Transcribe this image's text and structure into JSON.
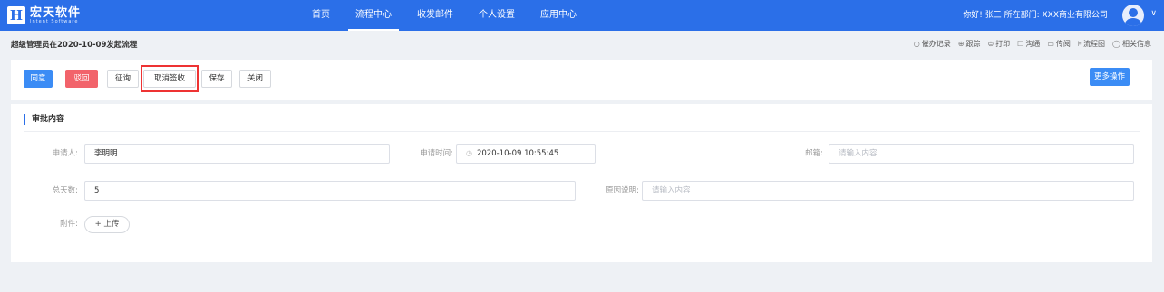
{
  "brand": {
    "logo_letter": "H",
    "name": "宏天软件",
    "sub": "Intent Software"
  },
  "nav": [
    {
      "label": "首页",
      "active": false
    },
    {
      "label": "流程中心",
      "active": true
    },
    {
      "label": "收发邮件",
      "active": false
    },
    {
      "label": "个人设置",
      "active": false
    },
    {
      "label": "应用中心",
      "active": false
    }
  ],
  "user": {
    "greeting": "你好! 张三 所在部门: XXX商业有限公司",
    "caret": "∨"
  },
  "crumb": "超级管理员在2020-10-09发起流程",
  "toolbar_links": [
    {
      "icon": "○",
      "label": "催办记录"
    },
    {
      "icon": "⊕",
      "label": "跟踪"
    },
    {
      "icon": "⊜",
      "label": "打印"
    },
    {
      "icon": "☐",
      "label": "沟通"
    },
    {
      "icon": "▭",
      "label": "传阅"
    },
    {
      "icon": "⊧",
      "label": "流程图"
    },
    {
      "icon": "◯",
      "label": "相关信息"
    }
  ],
  "actions": {
    "agree": "同意",
    "reject": "驳回",
    "consult": "征询",
    "cancel_sign": "取消签收",
    "save": "保存",
    "close": "关闭",
    "more": "更多操作"
  },
  "form": {
    "section_title": "审批内容",
    "applicant_label": "申请人:",
    "applicant_value": "李明明",
    "apply_time_label": "申请时间:",
    "apply_time_value": "2020-10-09 10:55:45",
    "email_label": "邮箱:",
    "email_placeholder": "请输入内容",
    "days_label": "总天数:",
    "days_value": "5",
    "reason_label": "原因说明:",
    "reason_placeholder": "请输入内容",
    "attachment_label": "附件:",
    "upload_label": "+ 上传"
  },
  "colors": {
    "primary": "#2b6fe8",
    "button_blue": "#3b8cf5",
    "button_red": "#f2636b",
    "highlight": "#e33333"
  }
}
